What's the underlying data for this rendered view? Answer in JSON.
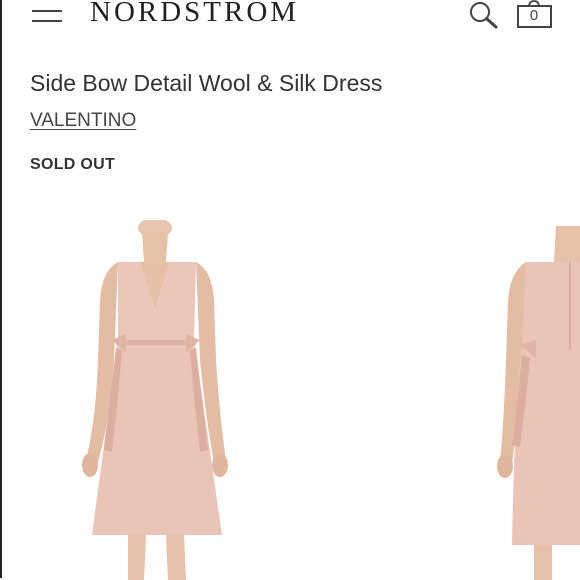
{
  "header": {
    "logo": "NORDSTROM",
    "bag_count": "0",
    "icons": {
      "menu": "hamburger-menu-icon",
      "search": "search-icon",
      "bag": "shopping-bag-icon"
    }
  },
  "product": {
    "title": "Side Bow Detail Wool & Silk Dress",
    "brand": "VALENTINO",
    "status": "SOLD OUT"
  },
  "colors": {
    "dress": "#ebc4b8",
    "dress_shadow": "#d9aa9c",
    "skin": "#e7c3ab",
    "text": "#333333"
  }
}
